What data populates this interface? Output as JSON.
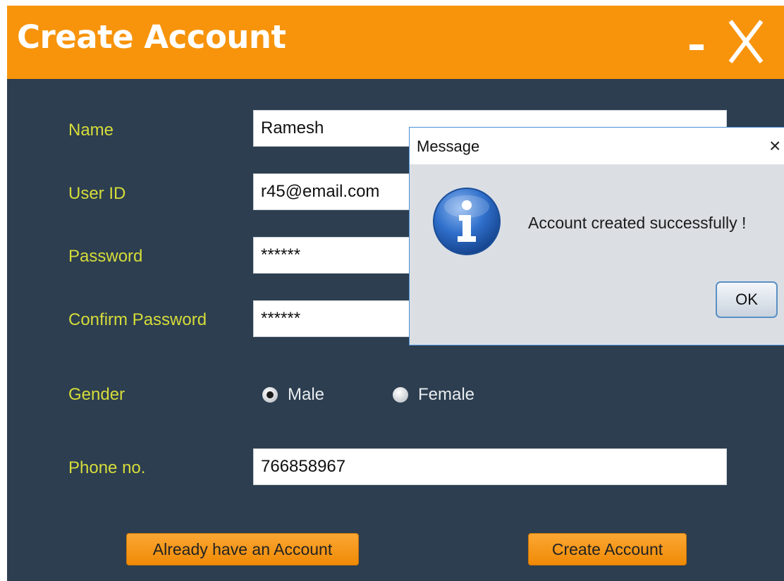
{
  "window": {
    "title": "Create Account",
    "minimize_icon": "minimize-icon",
    "close_icon": "close-icon"
  },
  "form": {
    "name": {
      "label": "Name",
      "value": "Ramesh"
    },
    "user_id": {
      "label": "User ID",
      "value": "r45@email.com"
    },
    "password": {
      "label": "Password",
      "value": "******"
    },
    "confirm_password": {
      "label": "Confirm Password",
      "value": "******"
    },
    "gender": {
      "label": "Gender",
      "options": [
        "Male",
        "Female"
      ],
      "selected": "Male"
    },
    "phone": {
      "label": "Phone no.",
      "value": "766858967"
    }
  },
  "buttons": {
    "already_have_account": "Already have an Account",
    "create_account": "Create Account"
  },
  "dialog": {
    "title": "Message",
    "close_glyph": "×",
    "icon": "info-icon",
    "message": "Account created successfully !",
    "ok_label": "OK"
  },
  "colors": {
    "titlebar": "#f7940c",
    "background": "#2c3e50",
    "label_text": "#d6dc39",
    "button": "#f7940c"
  }
}
